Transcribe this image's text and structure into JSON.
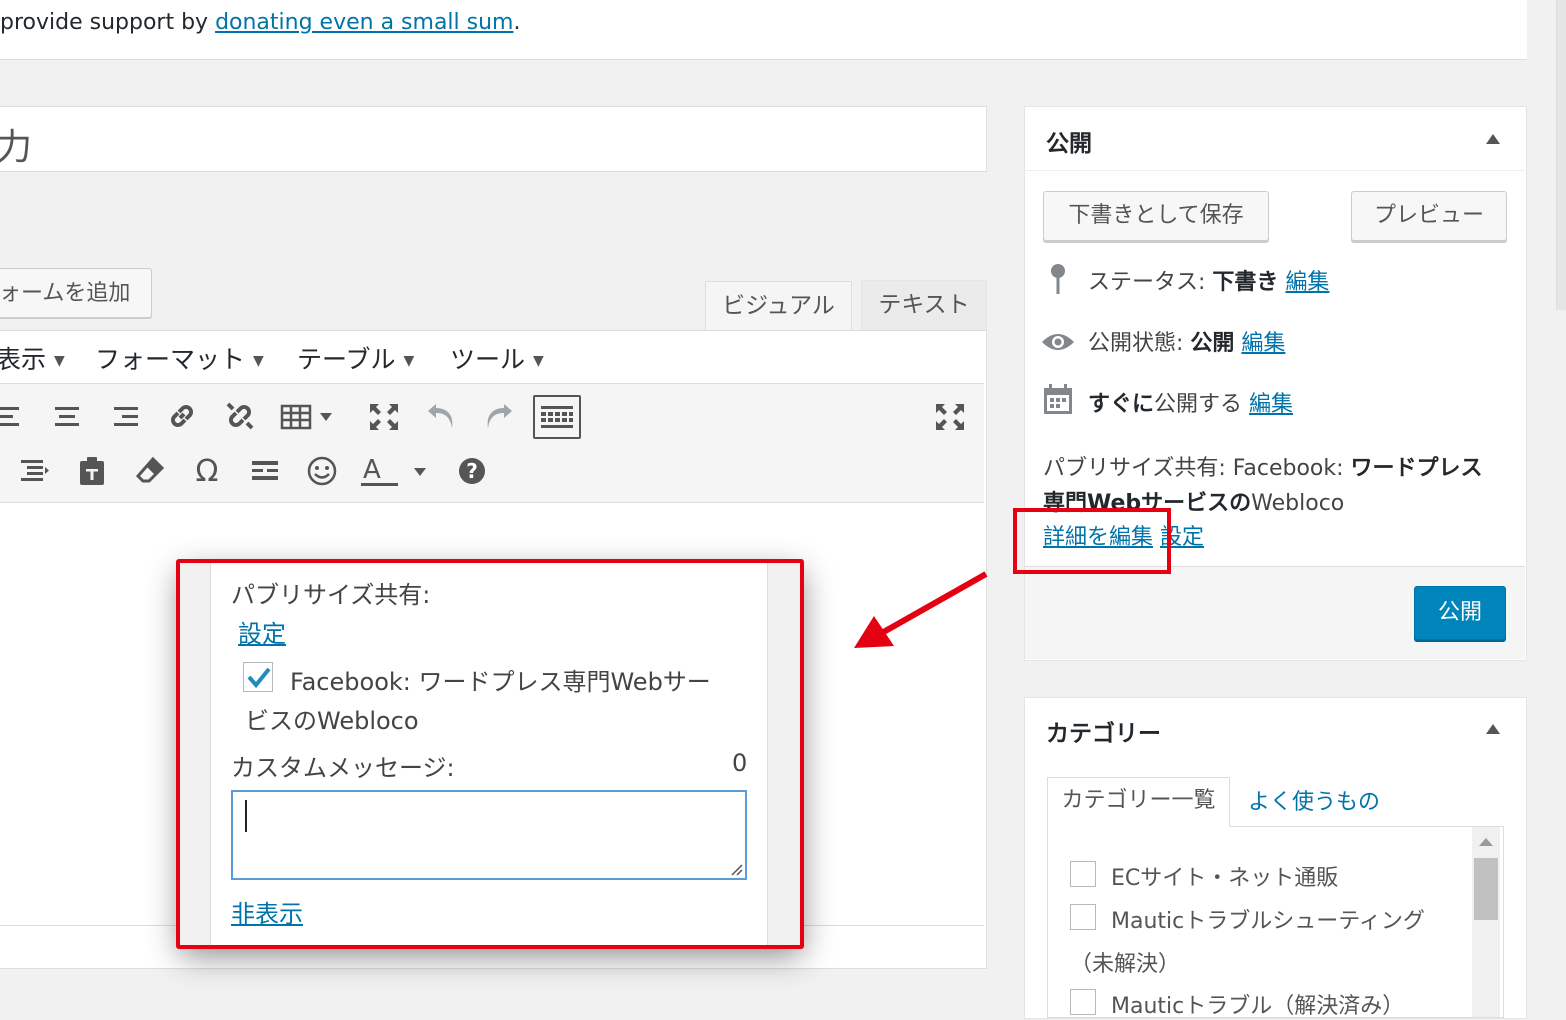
{
  "notice": {
    "prefix": "provide support by ",
    "link": "donating even a small sum",
    "suffix": "."
  },
  "title_input": {
    "value": "力"
  },
  "editor": {
    "add_form_label": "ォームを追加",
    "tabs": {
      "visual": "ビジュアル",
      "text": "テキスト"
    },
    "menus": [
      "表示",
      "フォーマット",
      "テーブル",
      "ツール"
    ]
  },
  "publish_box": {
    "title": "公開",
    "save_draft": "下書きとして保存",
    "preview": "プレビュー",
    "status_label": "ステータス: ",
    "status_value": "下書き",
    "visibility_label": "公開状態: ",
    "visibility_value": "公開",
    "schedule_bold": "すぐに",
    "schedule_rest": "公開する",
    "edit": "編集",
    "publicize_label": "パブリサイズ共有: ",
    "publicize_account_a": "Facebook: ",
    "publicize_account_b": "ワードプレス",
    "publicize_account_line2": "専門Webサービスの",
    "publicize_account_end": "Webloco",
    "edit_details": "詳細を編集",
    "settings": "設定",
    "publish_button": "公開"
  },
  "categories_box": {
    "title": "カテゴリー",
    "tab_all": "カテゴリー一覧",
    "tab_popular": "よく使うもの",
    "items": [
      "ECサイト・ネット通販",
      "Mauticトラブルシューティング",
      "（未解決）",
      "Mauticトラブル（解決済み）"
    ]
  },
  "popup": {
    "title": "パブリサイズ共有:",
    "settings_link": "設定",
    "account_line1": "Facebook: ワードプレス専門Webサー",
    "account_line2": "ビスのWebloco",
    "account_checked": true,
    "message_label": "カスタムメッセージ:",
    "message_count": "0",
    "message_value": "",
    "hide_link": "非表示"
  },
  "colors": {
    "accent": "#0073aa",
    "primary_button": "#0085ba",
    "highlight": "#e50012"
  }
}
